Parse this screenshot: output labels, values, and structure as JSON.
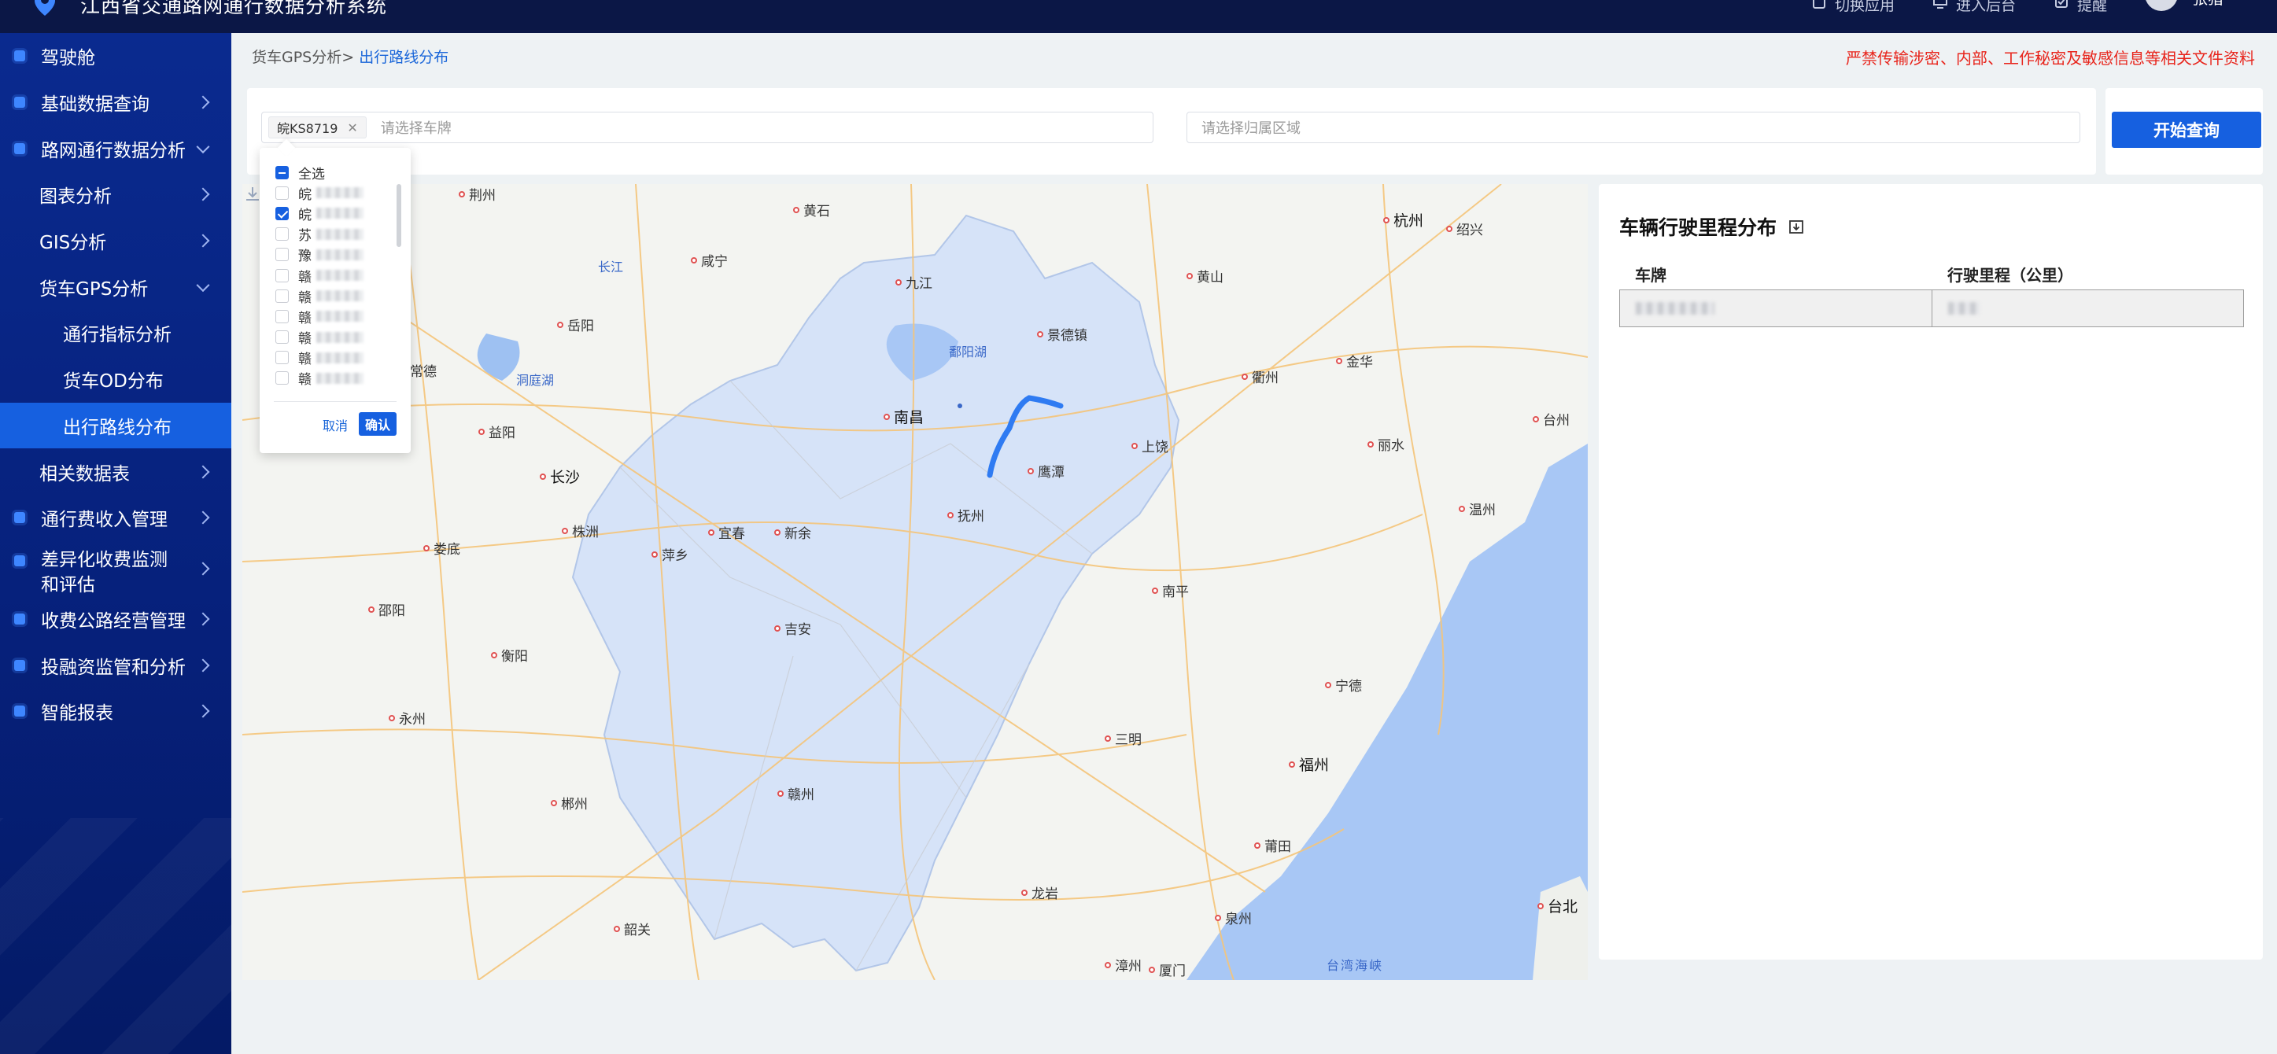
{
  "header": {
    "title": "江西省交通路网通行数据分析系统",
    "actions": [
      {
        "label": "切换应用",
        "icon": "switch-icon"
      },
      {
        "label": "进入后台",
        "icon": "monitor-icon"
      },
      {
        "label": "提醒",
        "icon": "bell-icon"
      }
    ],
    "user": "张猎"
  },
  "sidebar": {
    "items": [
      {
        "label": "驾驶舱"
      },
      {
        "label": "基础数据查询"
      },
      {
        "label": "路网通行数据分析"
      },
      {
        "label": "图表分析"
      },
      {
        "label": "GIS分析"
      },
      {
        "label": "货车GPS分析"
      },
      {
        "label": "通行指标分析"
      },
      {
        "label": "货车OD分布"
      },
      {
        "label": "出行路线分布"
      },
      {
        "label": "相关数据表"
      },
      {
        "label": "通行费收入管理"
      },
      {
        "label": "差异化收费监测和评估"
      },
      {
        "label": "收费公路经营管理"
      },
      {
        "label": "投融资监管和分析"
      },
      {
        "label": "智能报表"
      }
    ]
  },
  "breadcrumb": {
    "parent": "货车GPS分析>",
    "current": "出行路线分布"
  },
  "warning": "严禁传输涉密、内部、工作秘密及敏感信息等相关文件资料",
  "filter": {
    "selected_tag": "皖KS8719",
    "plate_placeholder": "请选择车牌",
    "region_placeholder": "请选择归属区域",
    "query_button": "开始查询"
  },
  "dropdown": {
    "select_all": "全选",
    "options": [
      "皖",
      "皖",
      "苏",
      "豫",
      "赣",
      "赣",
      "赣",
      "赣",
      "赣",
      "赣"
    ],
    "cancel": "取消",
    "confirm": "确认"
  },
  "map": {
    "cities": [
      "荆州",
      "黄石",
      "杭州",
      "绍兴",
      "九江",
      "咸宁",
      "黄山",
      "岳阳",
      "景德镇",
      "鄱阳湖",
      "长江",
      "常德",
      "洞庭湖",
      "衢州",
      "金华",
      "南昌",
      "益阳",
      "上饶",
      "丽水",
      "台州",
      "长沙",
      "鹰潭",
      "抚州",
      "温州",
      "株洲",
      "宜春",
      "新余",
      "萍乡",
      "娄底",
      "南平",
      "邵阳",
      "吉安",
      "衡阳",
      "宁德",
      "永州",
      "三明",
      "福州",
      "郴州",
      "赣州",
      "莆田",
      "龙岩",
      "泉州",
      "韶关",
      "台北",
      "漳州",
      "厦门",
      "台湾海峡"
    ]
  },
  "panel": {
    "title": "车辆行驶里程分布",
    "columns": [
      "车牌",
      "行驶里程（公里）"
    ]
  },
  "colors": {
    "accent": "#1660e0",
    "header": "#0b1746",
    "warning": "#e8251c",
    "province": "#d6e3f8"
  }
}
